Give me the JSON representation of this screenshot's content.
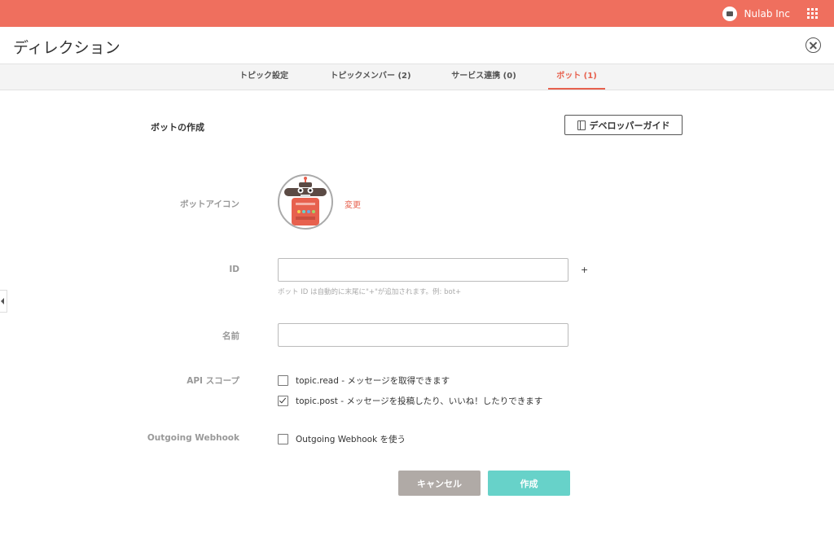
{
  "topbar": {
    "org_name": "Nulab Inc",
    "org_icon": "briefcase-icon",
    "apps_icon": "grid-icon",
    "color": "#ef6f5e"
  },
  "header": {
    "title": "ディレクション",
    "close_icon": "close-icon"
  },
  "tabs": [
    {
      "label": "トピック設定",
      "active": false
    },
    {
      "label": "トピックメンバー (2)",
      "active": false
    },
    {
      "label": "サービス連携 (0)",
      "active": false
    },
    {
      "label": "ボット (1)",
      "active": true
    }
  ],
  "form": {
    "section_title": "ボットの作成",
    "dev_guide_label": "デベロッパーガイド",
    "bot_icon_label": "ボットアイコン",
    "change_label": "変更",
    "id_label": "ID",
    "id_value": "",
    "id_suffix": "+",
    "id_hint": "ボット ID は自動的に末尾に\"+\"が追加されます。例: bot+",
    "name_label": "名前",
    "name_value": "",
    "api_scope_label": "API スコープ",
    "scopes": [
      {
        "label": "topic.read - メッセージを取得できます",
        "checked": false
      },
      {
        "label": "topic.post - メッセージを投稿したり、いいね！したりできます",
        "checked": true
      }
    ],
    "webhook_label": "Outgoing Webhook",
    "webhook_option": {
      "label": "Outgoing Webhook を使う",
      "checked": false
    },
    "cancel_label": "キャンセル",
    "create_label": "作成"
  },
  "colors": {
    "accent": "#e7614e",
    "cancel": "#b0aaa6",
    "create": "#67d2c9"
  }
}
